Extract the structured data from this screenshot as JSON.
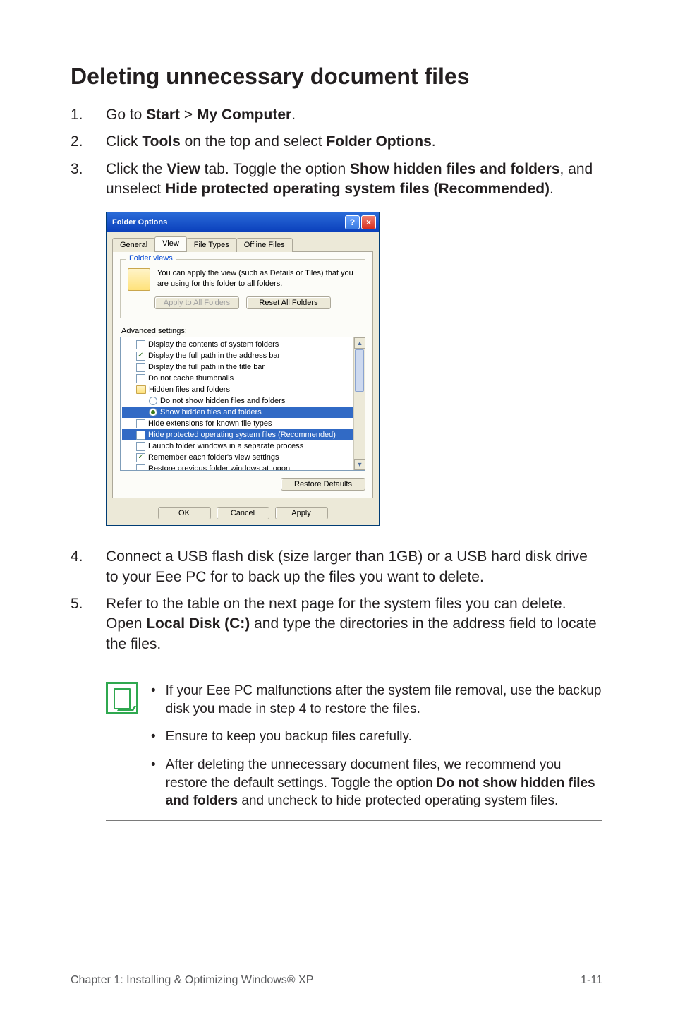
{
  "heading": "Deleting unnecessary document files",
  "steps": {
    "s1": {
      "num": "1.",
      "pre": "Go to ",
      "b1": "Start",
      "mid": " > ",
      "b2": "My Computer",
      "post": "."
    },
    "s2": {
      "num": "2.",
      "pre": "Click ",
      "b1": "Tools",
      "mid": " on the top and select ",
      "b2": "Folder Options",
      "post": "."
    },
    "s3": {
      "num": "3.",
      "pre": "Click the ",
      "b1": "View",
      "mid1": " tab. Toggle the option ",
      "b2": "Show hidden files and folders",
      "mid2": ", and unselect ",
      "b3": "Hide protected operating system files (Recommended)",
      "post": "."
    },
    "s4": {
      "num": "4.",
      "text": "Connect a USB flash disk (size larger than 1GB) or a USB hard disk drive to your Eee PC for to back up the files you want to delete."
    },
    "s5": {
      "num": "5.",
      "pre": "Refer to the table on the next page for the system files you can delete. Open ",
      "b1": "Local Disk (C:)",
      "post": " and type the directories in the address field to locate the files."
    }
  },
  "dialog": {
    "title": "Folder Options",
    "help": "?",
    "close": "×",
    "tabs": {
      "general": "General",
      "view": "View",
      "filetypes": "File Types",
      "offline": "Offline Files"
    },
    "group_legend": "Folder views",
    "fv_text": "You can apply the view (such as Details or Tiles) that you are using for this folder to all folders.",
    "btn_apply_all": "Apply to All Folders",
    "btn_reset_all": "Reset All Folders",
    "adv_label": "Advanced settings:",
    "tree": {
      "t1": "Display the contents of system folders",
      "t2": "Display the full path in the address bar",
      "t3": "Display the full path in the title bar",
      "t4": "Do not cache thumbnails",
      "t5": "Hidden files and folders",
      "t6": "Do not show hidden files and folders",
      "t7": "Show hidden files and folders",
      "t8": "Hide extensions for known file types",
      "t9": "Hide protected operating system files (Recommended)",
      "t10": "Launch folder windows in a separate process",
      "t11": "Remember each folder's view settings",
      "t12": "Restore previous folder windows at logon"
    },
    "btn_restore": "Restore Defaults",
    "btn_ok": "OK",
    "btn_cancel": "Cancel",
    "btn_apply": "Apply"
  },
  "notes": {
    "n1": "If your Eee PC malfunctions after the system file removal, use the backup disk you made in step 4 to restore the files.",
    "n2": "Ensure to keep you backup files carefully.",
    "n3_pre": "After deleting the unnecessary document files, we recommend you restore the default settings. Toggle the option ",
    "n3_b": "Do not show hidden files and folders",
    "n3_post": " and uncheck to hide protected operating system files."
  },
  "footer": {
    "left": "Chapter 1:   Installing & Optimizing Windows® XP",
    "right": "1-11"
  },
  "bullet": "•"
}
